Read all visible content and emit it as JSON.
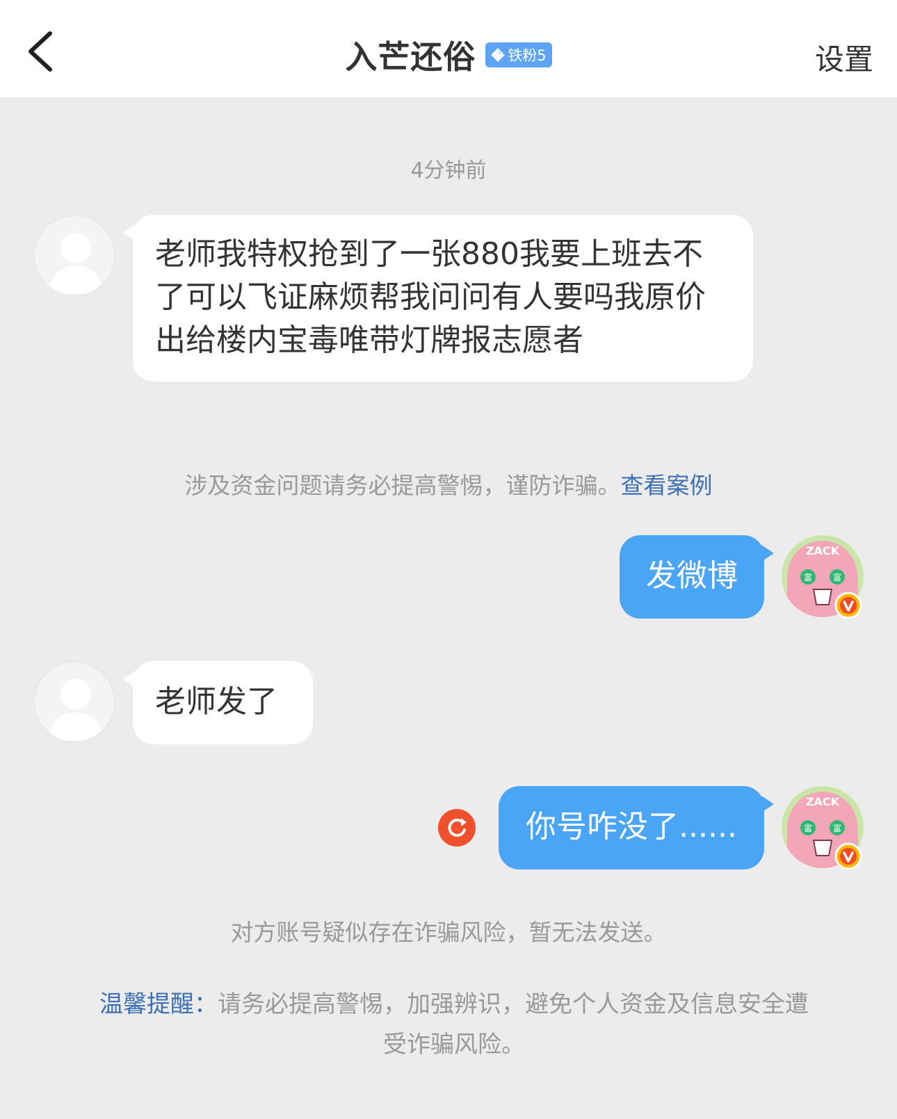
{
  "header": {
    "title": "入芒还俗",
    "fan_badge": "铁粉5",
    "settings_label": "设置"
  },
  "timestamp": "4分钟前",
  "messages": [
    {
      "side": "left",
      "text": "老师我特权抢到了一张880我要上班去不了可以飞证麻烦帮我问问有人要吗我原价出给楼内宝毒唯带灯牌报志愿者"
    },
    {
      "side": "right",
      "text": "发微博"
    },
    {
      "side": "left",
      "text": "老师发了"
    },
    {
      "side": "right",
      "text": "你号咋没了......",
      "status": "failed"
    }
  ],
  "notices": {
    "fraud_warning": "涉及资金问题请务必提高警惕，谨防诈骗。",
    "view_cases_link": "查看案例",
    "send_failed": "对方账号疑似存在诈骗风险，暂无法发送。"
  },
  "tip": {
    "label": "温馨提醒：",
    "text": "请务必提高警惕，加强辨识，避免个人资金及信息安全遭受诈骗风险。"
  },
  "colors": {
    "background": "#ececec",
    "header": "#ffffff",
    "bubble_mine": "#4aa5f6",
    "bubble_theirs": "#ffffff",
    "link": "#3b6fb6",
    "retry": "#f0502c",
    "verified_badge": "#ffb400"
  },
  "icons": {
    "back": "chevron-left-icon",
    "retry": "retry-icon",
    "verified": "verified-v-icon",
    "badge": "diamond-icon"
  },
  "avatar_texts": {
    "my_avatar_top": "ZACK",
    "my_avatar_eye": "富"
  }
}
